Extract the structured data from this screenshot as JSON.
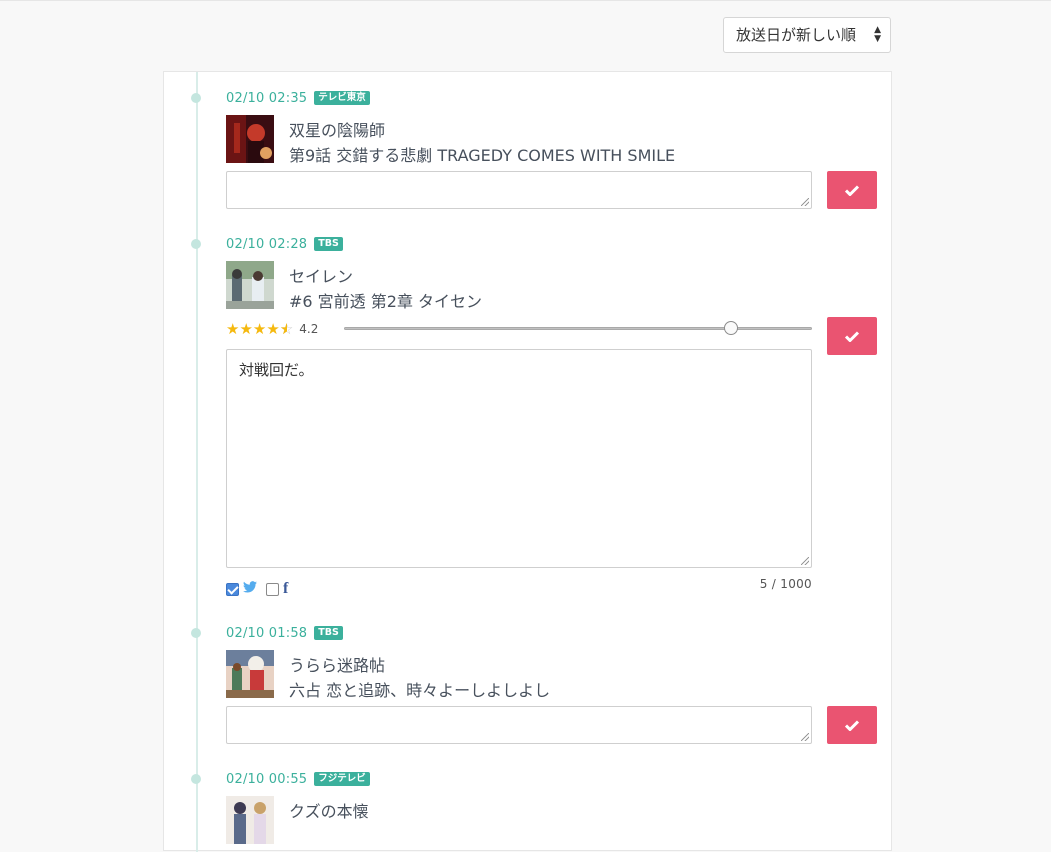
{
  "sort": {
    "label": "放送日が新しい順"
  },
  "entries": [
    {
      "time": "02/10 02:35",
      "channel": "テレビ東京",
      "title": "双星の陰陽師",
      "episode": "第9話  交錯する悲劇    TRAGEDY COMES WITH SMILE",
      "comment": ""
    },
    {
      "time": "02/10 02:28",
      "channel": "TBS",
      "title": "セイレン",
      "episode": "#6  宮前透 第2章 タイセン",
      "rating": "4.2",
      "rating_value": 4.2,
      "comment": "対戦回だ。",
      "char_count": "5 / 1000",
      "share_twitter": true,
      "share_facebook": false
    },
    {
      "time": "02/10 01:58",
      "channel": "TBS",
      "title": "うらら迷路帖",
      "episode": "六占  恋と追跡、時々よーしよしよし",
      "comment": ""
    },
    {
      "time": "02/10 00:55",
      "channel": "フジテレビ",
      "title": "クズの本懐"
    }
  ],
  "colors": {
    "accent": "#3bb09c",
    "button": "#ea5471",
    "star": "#f5b90f",
    "twitter": "#55acee",
    "facebook": "#3b5998"
  },
  "icons": {
    "check": "check-icon",
    "star": "star-icon",
    "twitter": "twitter-icon",
    "facebook": "facebook-icon",
    "sort": "sort-caret-icon"
  }
}
